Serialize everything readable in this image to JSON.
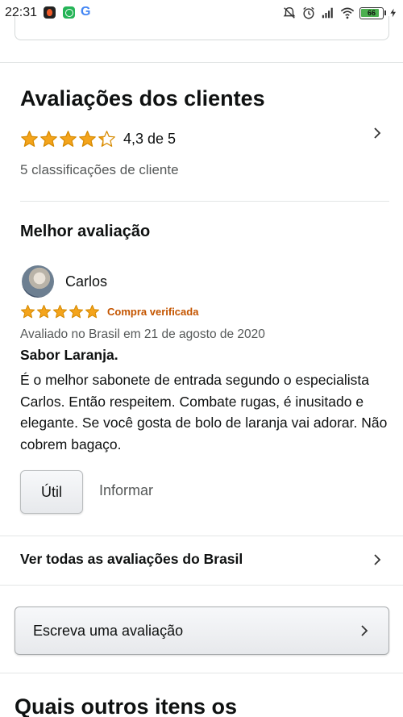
{
  "status_bar": {
    "time": "22:31",
    "battery_level": "66",
    "icons": [
      "notification-app-icon",
      "whatsapp-icon",
      "google-icon",
      "notifications-muted-icon",
      "alarm-icon",
      "signal-icon",
      "wifi-icon",
      "battery-icon",
      "charging-icon"
    ]
  },
  "reviews_summary": {
    "title": "Avaliações dos clientes",
    "rating": 4.3,
    "rating_text": "4,3 de 5",
    "ratings_count_text": "5 classificações de cliente"
  },
  "top_review": {
    "section_title": "Melhor avaliação",
    "reviewer_name": "Carlos",
    "stars": 5,
    "verified_label": "Compra verificada",
    "meta": "Avaliado no Brasil em 21 de agosto de 2020",
    "title": "Sabor Laranja.",
    "body": "É o melhor sabonete de entrada segundo o especialista Carlos. Então respeitem. Combate rugas, é inusitado e elegante. Se você gosta de bolo de laranja vai adorar. Não cobrem bagaço.",
    "helpful_label": "Útil",
    "report_label": "Informar"
  },
  "see_all_label": "Ver todas as avaliações do Brasil",
  "write_review_label": "Escreva uma avaliação",
  "next_section_title": "Quais outros itens os",
  "colors": {
    "star": "#f4a41c",
    "star_outline": "#d68a00",
    "verified": "#c45500",
    "text_secondary": "#565959",
    "divider": "#e3e6e6"
  }
}
